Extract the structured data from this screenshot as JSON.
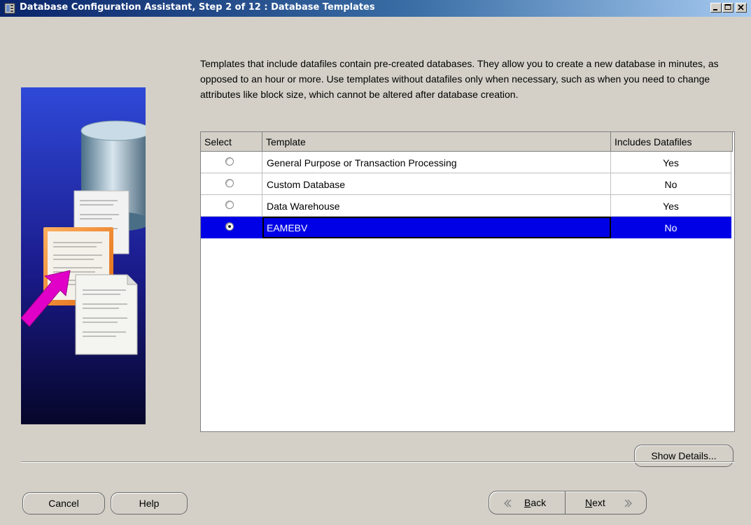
{
  "window": {
    "title": "Database Configuration Assistant, Step 2 of 12 : Database Templates",
    "icon": "dbca-app-icon",
    "controls": [
      "minimize-icon",
      "maximize-icon",
      "close-icon"
    ]
  },
  "description": "Templates that include datafiles contain pre-created databases. They allow you to create a new database in minutes, as opposed to an hour or more. Use templates without datafiles only when necessary, such as when you need to change attributes like block size, which cannot be altered after database creation.",
  "table": {
    "columns": [
      "Select",
      "Template",
      "Includes Datafiles"
    ],
    "rows": [
      {
        "template": "General Purpose or Transaction Processing",
        "includes_datafiles": "Yes",
        "selected": false
      },
      {
        "template": "Custom Database",
        "includes_datafiles": "No",
        "selected": false
      },
      {
        "template": "Data Warehouse",
        "includes_datafiles": "Yes",
        "selected": false
      },
      {
        "template": "EAMEBV",
        "includes_datafiles": "No",
        "selected": true
      }
    ]
  },
  "buttons": {
    "show_details": "Show Details...",
    "cancel": "Cancel",
    "help": "Help",
    "back": "Back",
    "back_mnemonic": "B",
    "back_rest": "ack",
    "next": "Next",
    "next_mnemonic": "N",
    "next_rest": "ext"
  },
  "colors": {
    "selection": "#0000e6",
    "titlebar_start": "#0a246a",
    "titlebar_end": "#a6caf0",
    "panel_top": "#2f49d8",
    "panel_bottom": "#06062a",
    "arrow": "#e000c8"
  }
}
